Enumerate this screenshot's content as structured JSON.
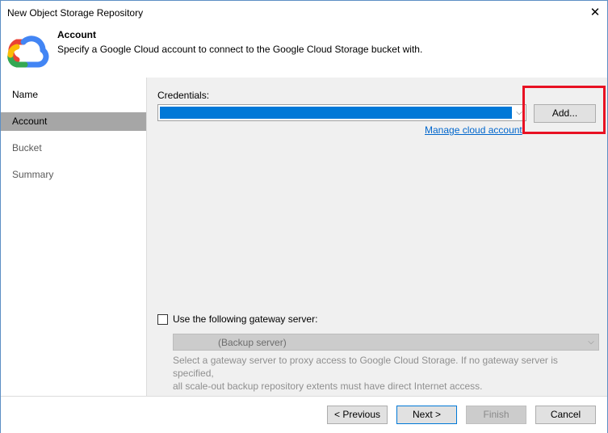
{
  "window": {
    "title": "New Object Storage Repository",
    "close_glyph": "✕"
  },
  "header": {
    "logo_icon": "google-cloud-icon",
    "title": "Account",
    "description": "Specify a Google Cloud account to connect to the Google Cloud Storage bucket with."
  },
  "sidebar": {
    "items": [
      {
        "label": "Name",
        "state": "normal"
      },
      {
        "label": "Account",
        "state": "active"
      },
      {
        "label": "Bucket",
        "state": "inactive"
      },
      {
        "label": "Summary",
        "state": "inactive"
      }
    ]
  },
  "credentials": {
    "label": "Credentials:",
    "selected_value": "",
    "add_label": "Add...",
    "manage_link": "Manage cloud account",
    "arrow_glyph": "⌵"
  },
  "gateway": {
    "checkbox_label": "Use the following gateway server:",
    "checked": false,
    "selected_value": "(Backup server)",
    "help_text_1": "Select a gateway server to proxy access to Google Cloud Storage. If no gateway server is specified,",
    "help_text_2": "all scale-out backup repository extents must have direct Internet access."
  },
  "footer": {
    "previous_label": "< Previous",
    "next_label": "Next >",
    "finish_label": "Finish",
    "cancel_label": "Cancel"
  },
  "colors": {
    "selection": "#0078d7",
    "highlight": "#e81123",
    "link": "#0066cc",
    "active_step": "#a6a6a6"
  }
}
